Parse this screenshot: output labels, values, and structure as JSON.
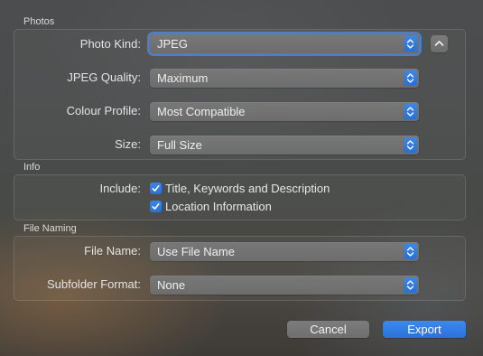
{
  "photos": {
    "title": "Photos",
    "photo_kind": {
      "label": "Photo Kind:",
      "value": "JPEG"
    },
    "jpeg_quality": {
      "label": "JPEG Quality:",
      "value": "Maximum"
    },
    "colour_profile": {
      "label": "Colour Profile:",
      "value": "Most Compatible"
    },
    "size": {
      "label": "Size:",
      "value": "Full Size"
    }
  },
  "info": {
    "title": "Info",
    "include_label": "Include:",
    "options": [
      {
        "label": "Title, Keywords and Description",
        "checked": true
      },
      {
        "label": "Location Information",
        "checked": true
      }
    ]
  },
  "file_naming": {
    "title": "File Naming",
    "file_name": {
      "label": "File Name:",
      "value": "Use File Name"
    },
    "subfolder_format": {
      "label": "Subfolder Format:",
      "value": "None"
    }
  },
  "buttons": {
    "cancel": "Cancel",
    "export": "Export"
  },
  "icons": {
    "popup_stepper": "up-down-chevron-icon",
    "disclosure": "chevron-up-icon",
    "checkbox": "checkmark-icon"
  },
  "colors": {
    "accent": "#2a70d6"
  }
}
